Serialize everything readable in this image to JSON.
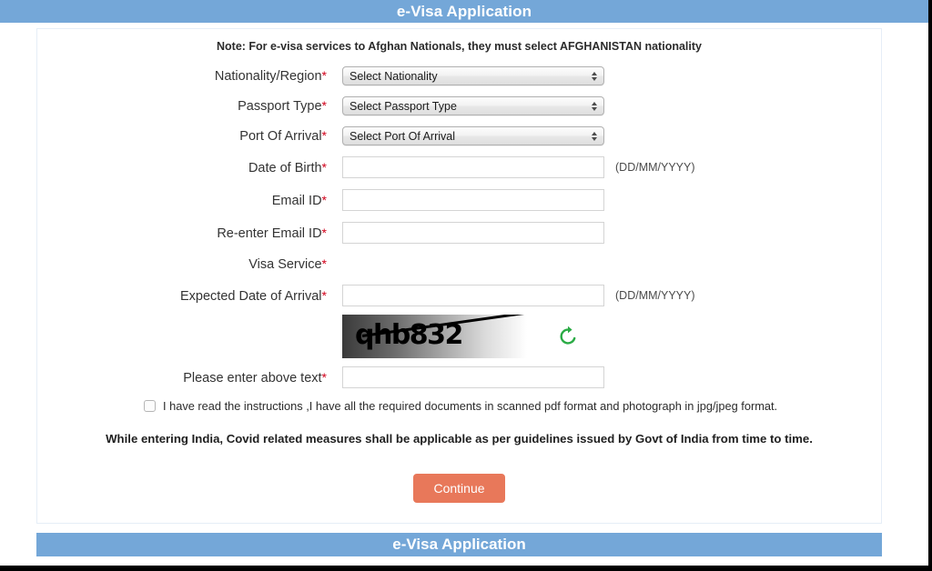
{
  "header": {
    "title": "e-Visa Application"
  },
  "footer": {
    "title": "e-Visa Application"
  },
  "note": "Note: For e-visa services to Afghan Nationals, they must select AFGHANISTAN nationality",
  "form": {
    "nationality": {
      "label": "Nationality/Region",
      "required": "*",
      "selected": "Select Nationality",
      "options": [
        "Select Nationality"
      ]
    },
    "passport_type": {
      "label": "Passport Type",
      "required": "*",
      "selected": "Select Passport Type",
      "options": [
        "Select Passport Type"
      ]
    },
    "port_of_arrival": {
      "label": "Port Of Arrival",
      "required": "*",
      "selected": "Select Port Of Arrival",
      "options": [
        "Select Port Of Arrival"
      ]
    },
    "date_of_birth": {
      "label": "Date of Birth",
      "required": "*",
      "value": "",
      "placeholder": "",
      "hint": "(DD/MM/YYYY)"
    },
    "email": {
      "label": "Email ID",
      "required": "*",
      "value": "",
      "placeholder": ""
    },
    "reenter_email": {
      "label": "Re-enter Email ID",
      "required": "*",
      "value": "",
      "placeholder": ""
    },
    "visa_service": {
      "label": "Visa Service",
      "required": "*"
    },
    "expected_date_of_arrival": {
      "label": "Expected Date of Arrival",
      "required": "*",
      "value": "",
      "placeholder": "",
      "hint": "(DD/MM/YYYY)"
    },
    "captcha": {
      "text": "qhb832",
      "refresh_icon": "refresh-icon",
      "refresh_color": "#2aab45",
      "input_label": "Please enter above text",
      "required": "*",
      "input_value": "",
      "input_placeholder": ""
    },
    "consent": {
      "checked": false,
      "label": "I have read the instructions ,I have all the required documents in scanned pdf format and photograph in jpg/jpeg format."
    }
  },
  "covid_notice": "While entering India, Covid related measures shall be applicable as per guidelines issued by Govt of India from time to time.",
  "actions": {
    "continue_label": "Continue"
  },
  "colors": {
    "title_bar": "#74a7d8",
    "continue_button": "#e8785a",
    "required_mark": "#d0021b",
    "refresh_icon": "#2aab45"
  }
}
